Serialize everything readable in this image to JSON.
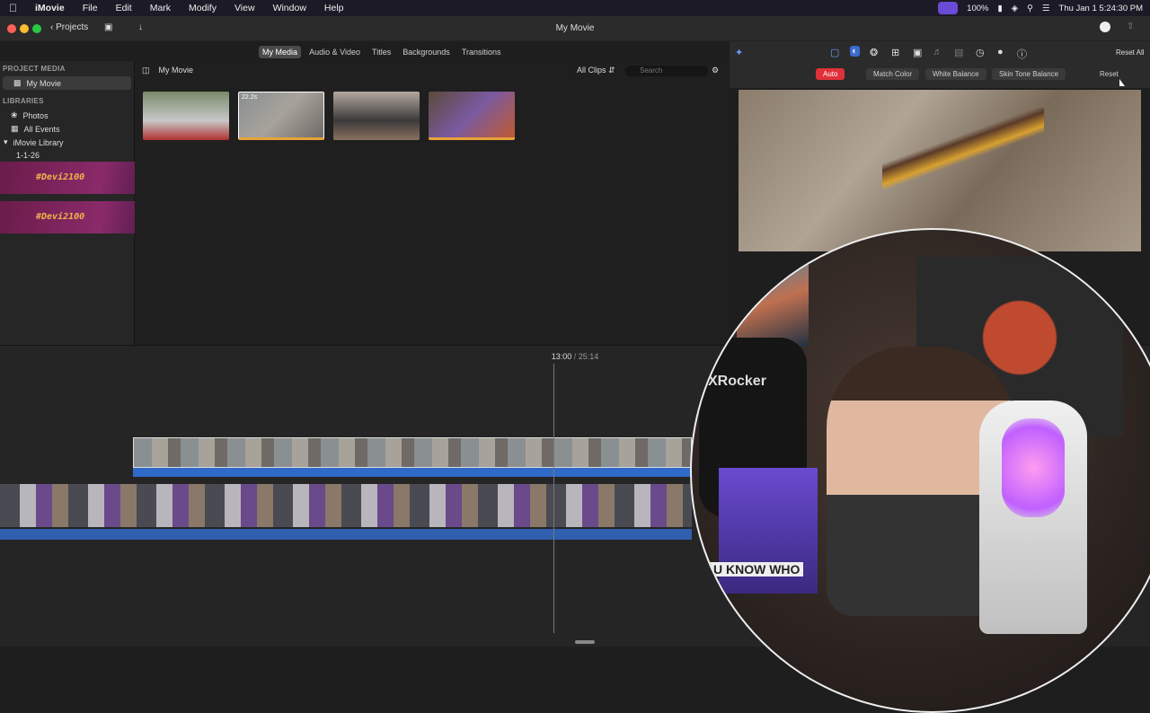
{
  "menubar": {
    "apple_icon": "apple-icon",
    "app_name": "iMovie",
    "items": [
      "File",
      "Edit",
      "Mark",
      "Modify",
      "View",
      "Window",
      "Help"
    ],
    "battery": "100%",
    "clock": "Thu Jan 1  5:24:30 PM"
  },
  "toolbar": {
    "projects_label": "Projects",
    "window_title": "My Movie"
  },
  "browser_tabs": [
    {
      "label": "My Media",
      "active": true
    },
    {
      "label": "Audio & Video"
    },
    {
      "label": "Titles"
    },
    {
      "label": "Backgrounds"
    },
    {
      "label": "Transitions"
    }
  ],
  "sidebar": {
    "project_media_header": "PROJECT MEDIA",
    "project_item": "My Movie",
    "libraries_header": "LIBRARIES",
    "items": [
      "Photos",
      "All Events",
      "iMovie Library",
      "1-1-26"
    ]
  },
  "media": {
    "title": "My Movie",
    "filter": "All Clips",
    "search_placeholder": "Search",
    "thumb_duration": "22.2s"
  },
  "banners": [
    "#Devi2100",
    "#Devi2100"
  ],
  "viewer": {
    "reset_all": "Reset All",
    "reset": "Reset",
    "color_tools": [
      "Auto",
      "Match Color",
      "White Balance",
      "Skin Tone Balance"
    ]
  },
  "timeline": {
    "current": "13:00",
    "separator": "/",
    "total": "25:14"
  },
  "webcam": {
    "chair_brand": "XRocker",
    "poster_text": "U KNOW WHO"
  },
  "colors": {
    "accent_red": "#e0303a",
    "audio_blue": "#2f5fae",
    "clip_blue": "#2f6ac8"
  }
}
